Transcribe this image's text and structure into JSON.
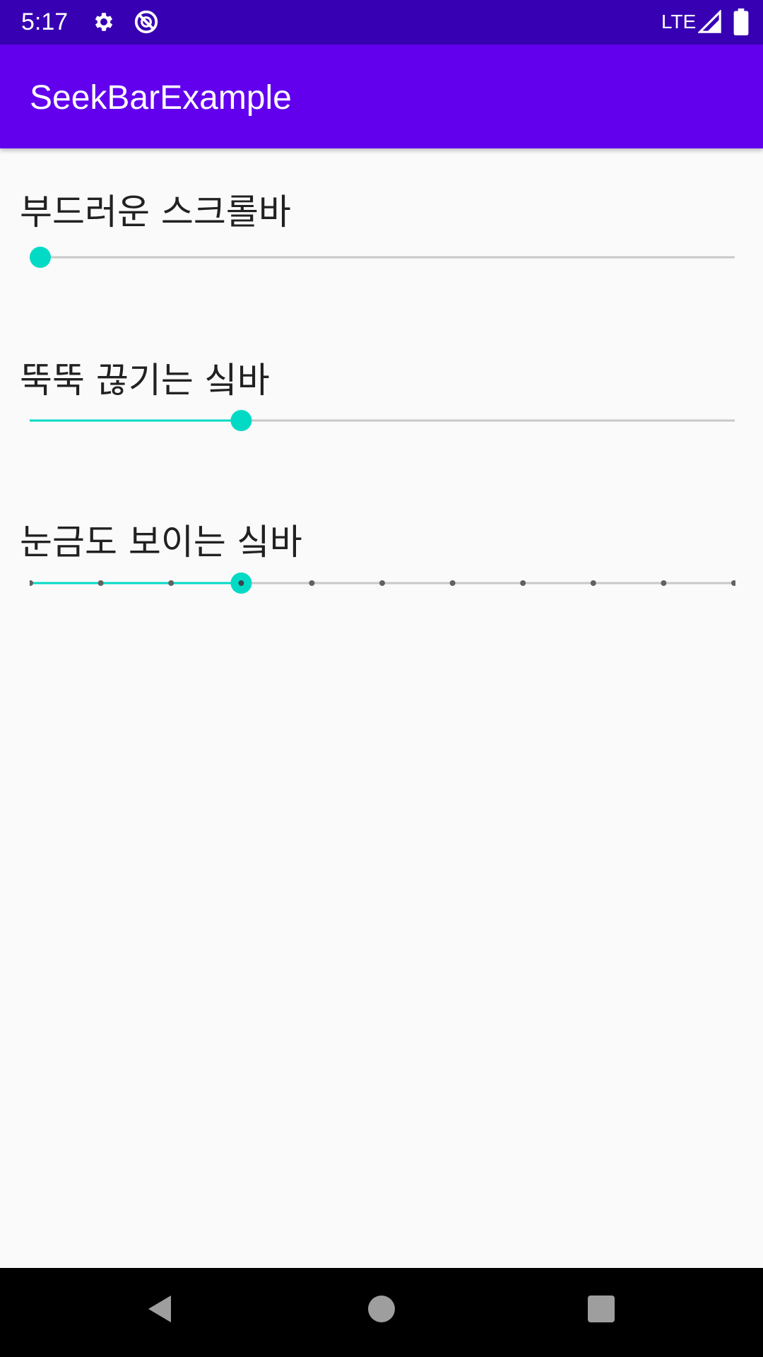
{
  "status_bar": {
    "time": "5:17",
    "network": "LTE",
    "icons": [
      "gear-icon",
      "dnd-icon",
      "signal-icon",
      "battery-icon"
    ],
    "background": "#3700b3"
  },
  "app_bar": {
    "title": "SeekBarExample",
    "background": "#6200ee"
  },
  "seekbars": [
    {
      "label": "부드러운 스크롤바",
      "progress": 0.0,
      "ticks": 0
    },
    {
      "label": "뚝뚝 끊기는 싴바",
      "progress": 0.3,
      "ticks": 0
    },
    {
      "label": "눈금도 보이는 싴바",
      "progress": 0.3,
      "ticks": 11
    }
  ],
  "colors": {
    "accent": "#03dac5",
    "track": "#c8c8c8",
    "tick": "#616161",
    "background": "#fafafa"
  },
  "nav_bar": {
    "icons": [
      "back-icon",
      "home-icon",
      "recents-icon"
    ]
  }
}
